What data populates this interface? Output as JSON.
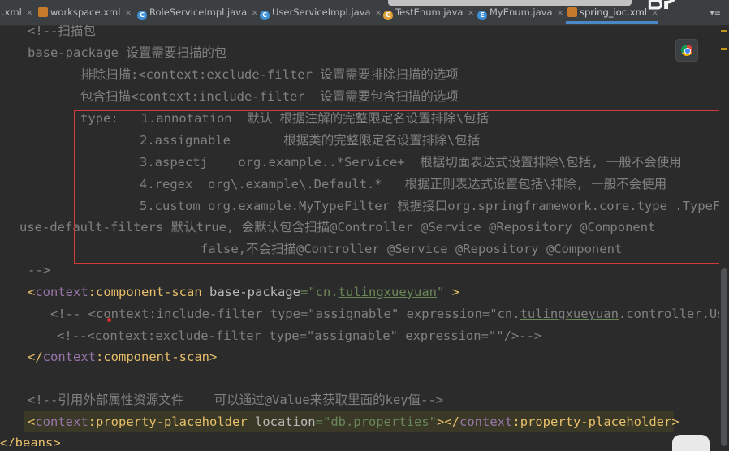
{
  "tabs": [
    {
      "label": ".xml",
      "kind": "xml",
      "active": false
    },
    {
      "label": "workspace.xml",
      "kind": "xml",
      "active": false
    },
    {
      "label": "RoleServiceImpl.java",
      "kind": "class",
      "active": false
    },
    {
      "label": "UserServiceImpl.java",
      "kind": "class",
      "active": false
    },
    {
      "label": "TestEnum.java",
      "kind": "test",
      "active": false
    },
    {
      "label": "MyEnum.java",
      "kind": "enum",
      "active": false
    },
    {
      "label": "spring_ioc.xml",
      "kind": "xml",
      "active": true
    }
  ],
  "tab_close_glyph": "×",
  "tab_overflow": "▾≡",
  "watermark": "bilibili",
  "code": {
    "l1": "<!--扫描包",
    "l2": "base-package 设置需要扫描的包",
    "l3": "排除扫描:<context:exclude-filter 设置需要排除扫描的选项",
    "l4": "包含扫描<context:include-filter  设置需要包含扫描的选项",
    "l5": "type:   1.annotation  默认 根据注解的完整限定名设置排除\\包括",
    "l6": "2.assignable       根据类的完整限定名设置排除\\包括",
    "l7": "3.aspectj    org.example..*Service+  根据切面表达式设置排除\\包括, 一般不会使用",
    "l8": "4.regex  org\\.example\\.Default.*   根据正则表达式设置包括\\排除, 一般不会使用",
    "l9": "5.custom org.example.MyTypeFilter 根据接口org.springframework.core.type .TypeFi",
    "l10": "use-default-filters 默认true, 会默认包含扫描@Controller @Service @Repository @Component",
    "l11": "false,不会扫描@Controller @Service @Repository @Component",
    "l12": "-->",
    "l13": {
      "open": "<",
      "ns": "context",
      "colon": ":",
      "name": "component-scan",
      "attr": " base-package",
      "eq": "=",
      "value_q1": "\"cn.",
      "value_ul": "tulingxueyuan",
      "value_q2": "\"",
      "close": " >"
    },
    "l14": {
      "a": "<!-- <",
      "ns": "context",
      "b": ":include-filter type=\"assignable\" expression=\"cn.",
      "ul": "tulingxueyuan",
      "c": ".controller.Use"
    },
    "l15": "<!--<context:exclude-filter type=\"assignable\" expression=\"\"/>-->",
    "l16": {
      "open": "</",
      "ns": "context",
      "colon": ":",
      "name": "component-scan",
      "close": ">"
    },
    "l17": "<!--引用外部属性资源文件    可以通过@Value来获取里面的key值-->",
    "l18": {
      "open": "<",
      "ns": "context",
      "colon": ":",
      "name": "property-placeholder",
      "attr": " location",
      "eq": "=",
      "value_q1": "\"",
      "value_ul": "db.properties",
      "value_q2": "\"",
      "mid": "></",
      "ns2": "context",
      "colon2": ":",
      "name2": "property-placeholder",
      "close": ">"
    },
    "l19": "</beans>"
  },
  "colors": {
    "background": "#2b2b2b",
    "comment": "#808080",
    "tag": "#e8bf6a",
    "namespace": "#9876aa",
    "string": "#6a8759",
    "highlight_box": "#d23a3a",
    "active_tab_underline": "#4a88c7"
  }
}
